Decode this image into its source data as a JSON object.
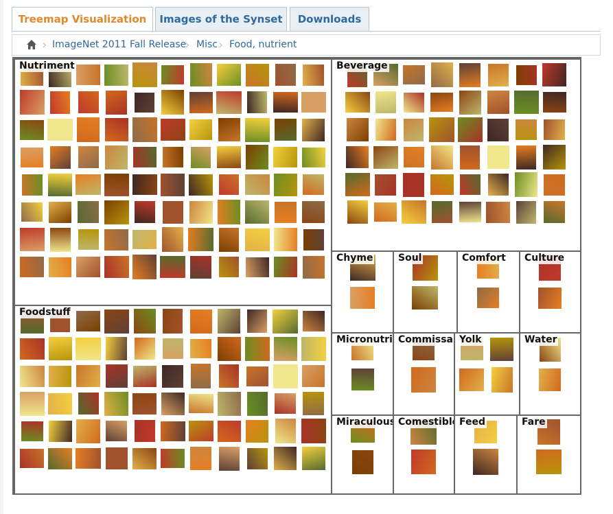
{
  "tabs": [
    {
      "label": "Treemap Visualization",
      "active": true
    },
    {
      "label": "Images of the Synset",
      "active": false
    },
    {
      "label": "Downloads",
      "active": false
    }
  ],
  "breadcrumb": {
    "home_icon": "home-icon",
    "items": [
      "ImageNet 2011 Fall Release",
      "Misc",
      "Food, nutrient"
    ]
  },
  "treemap": {
    "cells": [
      {
        "id": "nutriment",
        "label": "Nutriment"
      },
      {
        "id": "foodstuff",
        "label": "Foodstuff"
      },
      {
        "id": "beverage",
        "label": "Beverage"
      },
      {
        "id": "chyme",
        "label": "Chyme"
      },
      {
        "id": "soul",
        "label": "Soul"
      },
      {
        "id": "comfort",
        "label": "Comfort"
      },
      {
        "id": "culture",
        "label": "Culture"
      },
      {
        "id": "micronutrient",
        "label": "Micronutrie"
      },
      {
        "id": "commissary",
        "label": "Commissar"
      },
      {
        "id": "yolk",
        "label": "Yolk"
      },
      {
        "id": "water",
        "label": "Water"
      },
      {
        "id": "miraculous",
        "label": "Miraculous"
      },
      {
        "id": "comestible",
        "label": "Comestible"
      },
      {
        "id": "feed",
        "label": "Feed"
      },
      {
        "id": "fare",
        "label": "Fare"
      }
    ]
  },
  "colors": {
    "tab_active": "#e08a2c",
    "tab_link": "#2f6a9e",
    "treemap_border": "#666666",
    "thumb_palette": [
      "#8b4513",
      "#c8742a",
      "#e2b04a",
      "#6b8e23",
      "#a0522d",
      "#d2691e",
      "#f4d03f",
      "#7b3f00",
      "#c0392b",
      "#e67e22",
      "#556b2f",
      "#bdb76b",
      "#8e6b4a",
      "#d9a066",
      "#5d4037",
      "#a93226",
      "#f0e68c",
      "#3e2723",
      "#b7950b",
      "#cd853f"
    ]
  }
}
